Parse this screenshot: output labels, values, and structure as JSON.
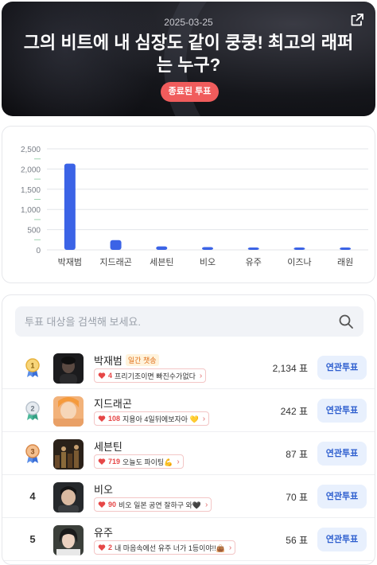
{
  "header": {
    "date": "2025-03-25",
    "title": "그의 비트에 내 심장도 같이 쿵쿵! 최고의 래퍼는 누구?",
    "status": "종료된 투표",
    "share_icon": "share-external-icon"
  },
  "chart_data": {
    "type": "bar",
    "categories": [
      "박재범",
      "지드래곤",
      "세븐틴",
      "비오",
      "유주",
      "이즈나",
      "래원"
    ],
    "values": [
      2134,
      242,
      87,
      70,
      56,
      50,
      45
    ],
    "yticks": [
      "0",
      "500",
      "1,000",
      "1,500",
      "2,000",
      "2,500"
    ],
    "ylim": [
      0,
      2500
    ],
    "color": "#3b63e6",
    "grid": true
  },
  "search": {
    "placeholder": "투표 대상을 검색해 보세요.",
    "icon": "search-icon"
  },
  "candidates": [
    {
      "rank": "1",
      "name": "박재범",
      "badge": "일간 챗송",
      "cheer_count": "4",
      "cheer_text": "프리기조이면 빠진수가없다",
      "votes": "2,134 표",
      "button": "연관투표"
    },
    {
      "rank": "2",
      "name": "지드래곤",
      "badge": "",
      "cheer_count": "108",
      "cheer_text": "지용아 4일뒤에보자아 💛",
      "votes": "242 표",
      "button": "연관투표"
    },
    {
      "rank": "3",
      "name": "세븐틴",
      "badge": "",
      "cheer_count": "719",
      "cheer_text": "오늘도 파이팅💪",
      "votes": "87 표",
      "button": "연관투표"
    },
    {
      "rank": "4",
      "name": "비오",
      "badge": "",
      "cheer_count": "90",
      "cheer_text": "비오 일본 공연 잘하구 와🖤",
      "votes": "70 표",
      "button": "연관투표"
    },
    {
      "rank": "5",
      "name": "유주",
      "badge": "",
      "cheer_count": "2",
      "cheer_text": "내 마음속에선 유주 너가 1등이야!!👜",
      "votes": "56 표",
      "button": "연관투표"
    }
  ],
  "colors": {
    "accent": "#3b63e6",
    "badge_red": "#f05c5c",
    "button_bg": "#e8f0fd",
    "button_text": "#2e5fcf",
    "gold": "#f3c24b",
    "silver": "#c9d2dc",
    "bronze": "#e8a26a"
  }
}
